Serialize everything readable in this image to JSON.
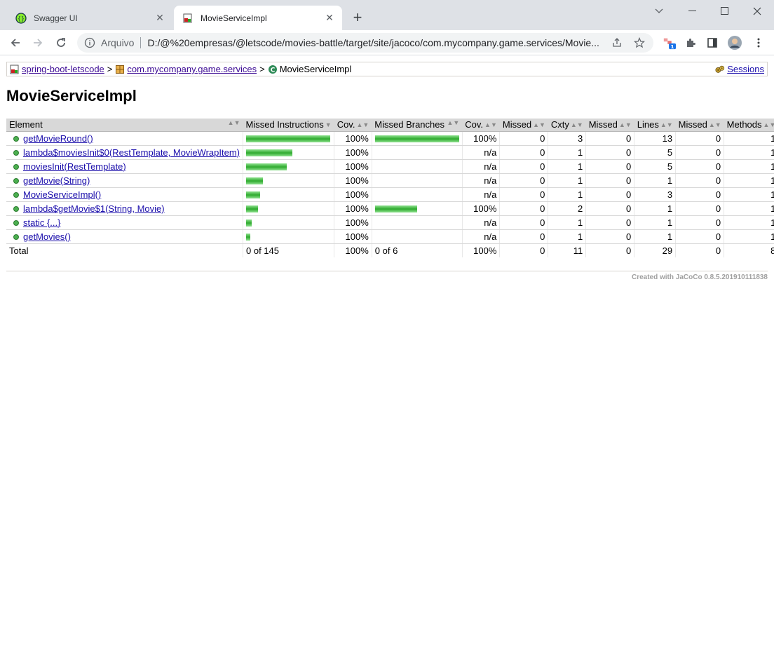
{
  "browser": {
    "tabs": [
      {
        "title": "Swagger UI",
        "active": false
      },
      {
        "title": "MovieServiceImpl",
        "active": true
      }
    ],
    "scheme": "Arquivo",
    "url": "D:/@%20empresas/@letscode/movies-battle/target/site/jacoco/com.mycompany.game.services/Movie...",
    "extension_badge": "1"
  },
  "breadcrumb": {
    "root": "spring-boot-letscode",
    "package": "com.mycompany.game.services",
    "current": "MovieServiceImpl",
    "separator": ">",
    "sessions": "Sessions"
  },
  "page_title": "MovieServiceImpl",
  "table": {
    "headers": [
      "Element",
      "Missed Instructions",
      "Cov.",
      "Missed Branches",
      "Cov.",
      "Missed",
      "Cxty",
      "Missed",
      "Lines",
      "Missed",
      "Methods"
    ],
    "rows": [
      {
        "element": "getMovieRound()",
        "instr_fraction": 1.0,
        "instr_cov": "100%",
        "branch_fraction": 1.0,
        "branch_cov": "100%",
        "missed_cxty": "0",
        "cxty": "3",
        "missed_lines": "0",
        "lines": "13",
        "missed_methods": "0",
        "methods": "1"
      },
      {
        "element": "lambda$moviesInit$0(RestTemplate, MovieWrapItem)",
        "instr_fraction": 0.55,
        "instr_cov": "100%",
        "branch_fraction": 0,
        "branch_cov": "n/a",
        "missed_cxty": "0",
        "cxty": "1",
        "missed_lines": "0",
        "lines": "5",
        "missed_methods": "0",
        "methods": "1"
      },
      {
        "element": "moviesInit(RestTemplate)",
        "instr_fraction": 0.48,
        "instr_cov": "100%",
        "branch_fraction": 0,
        "branch_cov": "n/a",
        "missed_cxty": "0",
        "cxty": "1",
        "missed_lines": "0",
        "lines": "5",
        "missed_methods": "0",
        "methods": "1"
      },
      {
        "element": "getMovie(String)",
        "instr_fraction": 0.2,
        "instr_cov": "100%",
        "branch_fraction": 0,
        "branch_cov": "n/a",
        "missed_cxty": "0",
        "cxty": "1",
        "missed_lines": "0",
        "lines": "1",
        "missed_methods": "0",
        "methods": "1"
      },
      {
        "element": "MovieServiceImpl()",
        "instr_fraction": 0.17,
        "instr_cov": "100%",
        "branch_fraction": 0,
        "branch_cov": "n/a",
        "missed_cxty": "0",
        "cxty": "1",
        "missed_lines": "0",
        "lines": "3",
        "missed_methods": "0",
        "methods": "1"
      },
      {
        "element": "lambda$getMovie$1(String, Movie)",
        "instr_fraction": 0.14,
        "instr_cov": "100%",
        "branch_fraction": 0.5,
        "branch_cov": "100%",
        "missed_cxty": "0",
        "cxty": "2",
        "missed_lines": "0",
        "lines": "1",
        "missed_methods": "0",
        "methods": "1"
      },
      {
        "element": "static {...}",
        "instr_fraction": 0.07,
        "instr_cov": "100%",
        "branch_fraction": 0,
        "branch_cov": "n/a",
        "missed_cxty": "0",
        "cxty": "1",
        "missed_lines": "0",
        "lines": "1",
        "missed_methods": "0",
        "methods": "1"
      },
      {
        "element": "getMovies()",
        "instr_fraction": 0.05,
        "instr_cov": "100%",
        "branch_fraction": 0,
        "branch_cov": "n/a",
        "missed_cxty": "0",
        "cxty": "1",
        "missed_lines": "0",
        "lines": "1",
        "missed_methods": "0",
        "methods": "1"
      }
    ],
    "total": {
      "label": "Total",
      "instr": "0 of 145",
      "instr_cov": "100%",
      "branch": "0 of 6",
      "branch_cov": "100%",
      "missed_cxty": "0",
      "cxty": "11",
      "missed_lines": "0",
      "lines": "29",
      "missed_methods": "0",
      "methods": "8"
    }
  },
  "footer": {
    "prefix": "Created with",
    "link": "JaCoCo",
    "version": "0.8.5.201910111838"
  },
  "colors": {
    "bar_green": "#2faa2f",
    "header_bg": "#d8d8d8",
    "link": "#1a0dab"
  }
}
